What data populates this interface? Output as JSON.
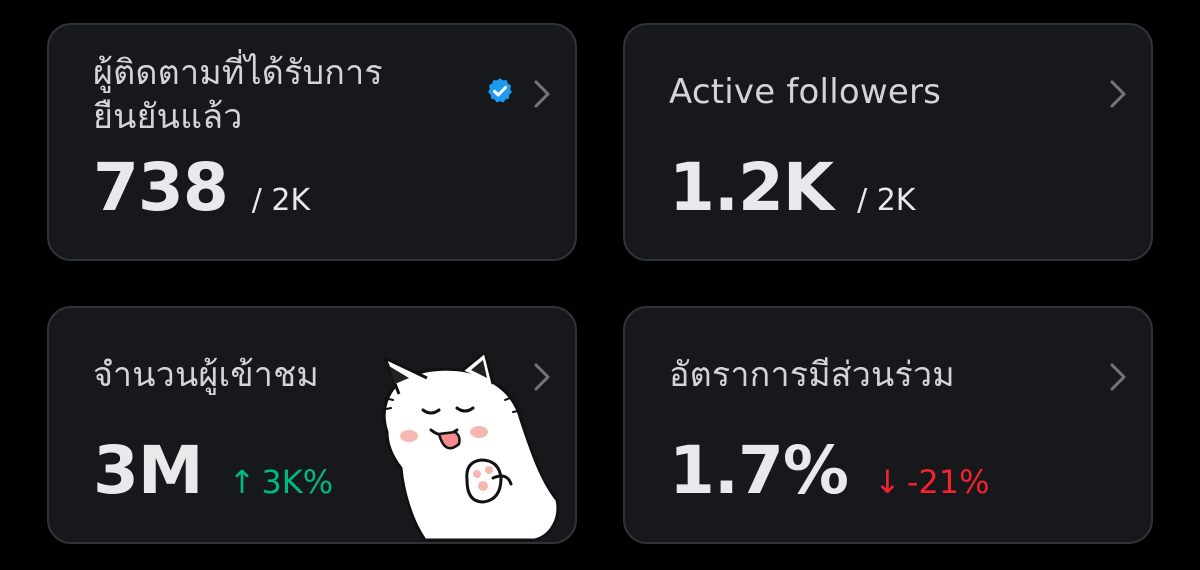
{
  "colors": {
    "background": "#000000",
    "card": "#16181c",
    "card_border": "#2f3336",
    "text_primary": "#e7e9ea",
    "text_label": "#d2d5d8",
    "positive": "#00ba7c",
    "negative": "#f4212e",
    "verified": "#1d9bf0"
  },
  "cards": [
    {
      "label": "ผู้ติดตามที่ได้รับการยืนยันแล้ว",
      "icon": "verified-badge-icon",
      "value": "738",
      "suffix": "/ 2K"
    },
    {
      "label": "Active followers",
      "value": "1.2K",
      "suffix": "/ 2K"
    },
    {
      "label": "จำนวนผู้เข้าชม",
      "value": "3M",
      "change": {
        "arrow": "↑",
        "text": "3K%",
        "direction": "up"
      }
    },
    {
      "label": "อัตราการมีส่วนร่วม",
      "value": "1.7%",
      "change": {
        "arrow": "↓",
        "text": "-21%",
        "direction": "down"
      }
    }
  ],
  "sticker": "cat-sticker"
}
